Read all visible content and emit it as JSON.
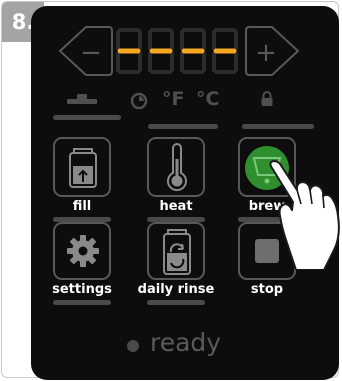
{
  "step": "8.",
  "display": {
    "digits": "----",
    "minus_symbol": "−",
    "plus_symbol": "+"
  },
  "indicators": {
    "fahrenheit": "°F",
    "celsius": "°C"
  },
  "buttons": {
    "fill": "fill",
    "heat": "heat",
    "brew": "brew",
    "settings": "settings",
    "daily_rinse": "daily rinse",
    "stop": "stop"
  },
  "status": {
    "ready": "ready"
  },
  "colors": {
    "panel": "#0d0d0d",
    "digit_active": "#f5a623",
    "brew_highlight": "#2f8f2f",
    "button_border": "#585858"
  }
}
